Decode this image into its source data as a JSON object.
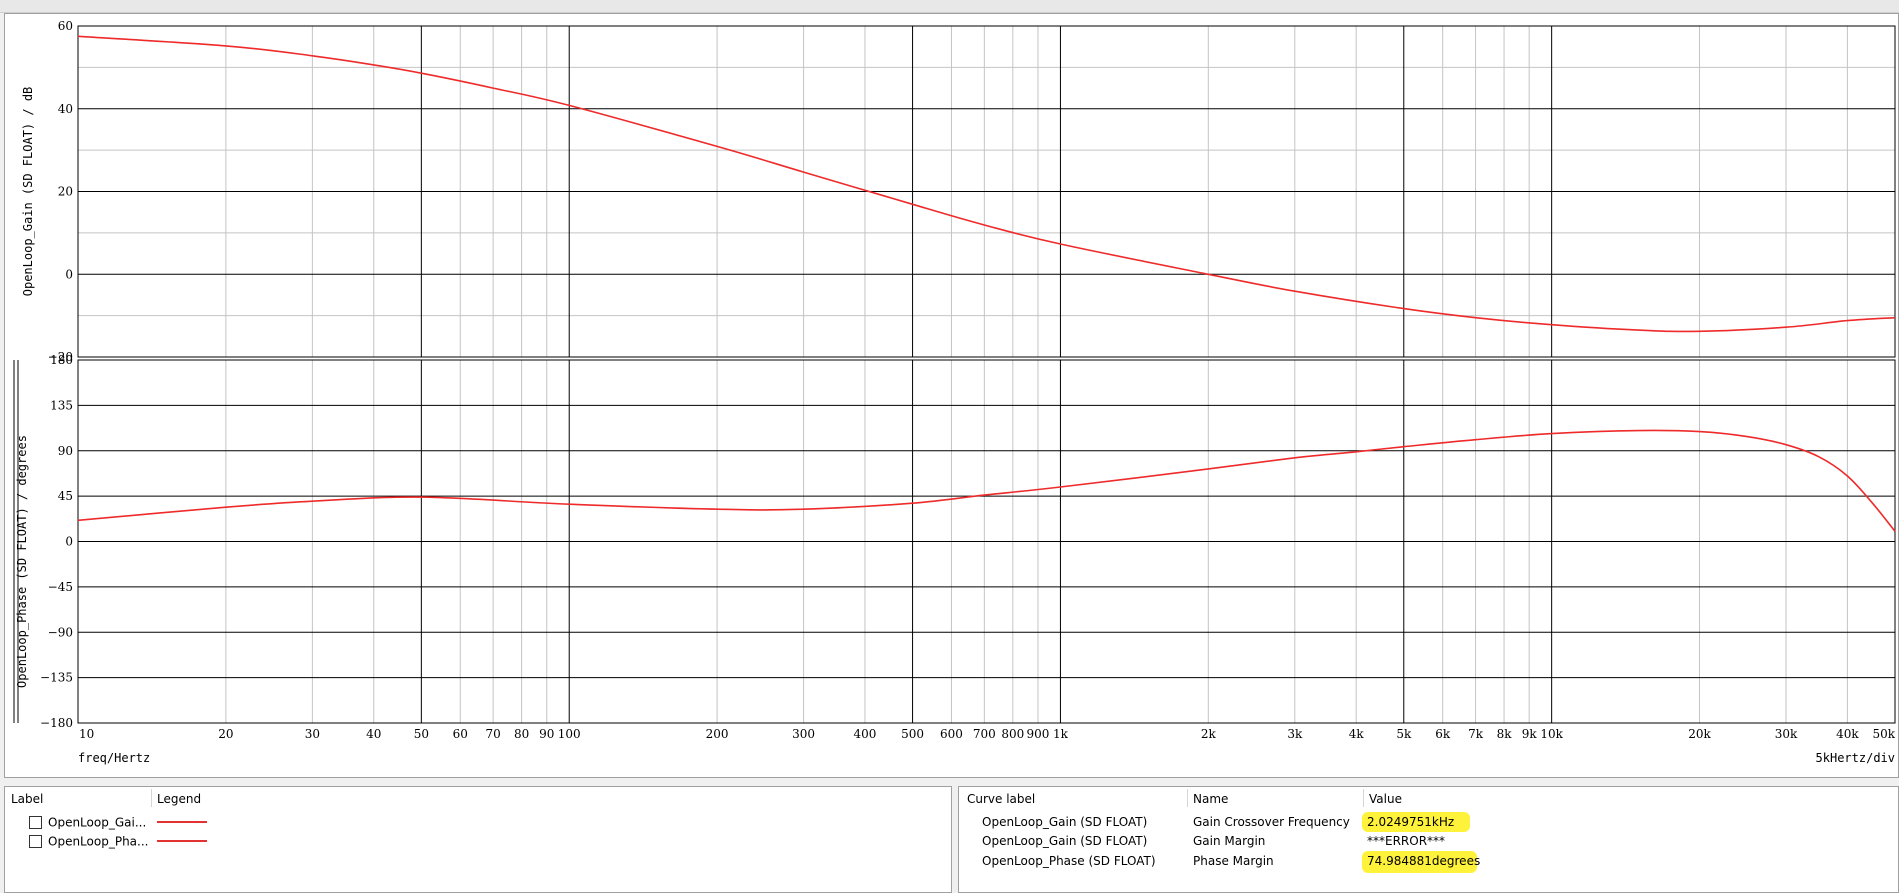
{
  "colors": {
    "curve": "#ee2a2a",
    "highlight": "#fff23a",
    "grid_major": "#000000",
    "grid_minor": "#c4c4c4"
  },
  "chart_data": [
    {
      "type": "line",
      "ylabel": "OpenLoop_Gain (SD FLOAT) / dB",
      "xscale": "log",
      "xlim": [
        10,
        50000
      ],
      "ylim": [
        -20,
        60
      ],
      "yticks": [
        60,
        40,
        20,
        0,
        -20
      ],
      "series": [
        {
          "name": "OpenLoop_Gain (SD FLOAT)",
          "x": [
            10,
            20,
            30,
            40,
            50,
            70,
            100,
            200,
            300,
            500,
            700,
            1000,
            2000,
            3000,
            5000,
            7000,
            10000,
            15000,
            20000,
            30000,
            40000,
            50000
          ],
          "y": [
            57.5,
            55.2,
            52.8,
            50.6,
            48.6,
            45.0,
            40.8,
            30.9,
            24.7,
            16.9,
            11.9,
            7.3,
            0.0,
            -4.1,
            -8.3,
            -10.5,
            -12.2,
            -13.5,
            -13.8,
            -12.8,
            -11.2,
            -10.5
          ]
        }
      ]
    },
    {
      "type": "line",
      "ylabel": "OpenLoop_Phase (SD FLOAT) / degrees",
      "xlabel": "freq/Hertz",
      "xscale": "log",
      "xlim": [
        10,
        50000
      ],
      "ylim": [
        -180,
        180
      ],
      "yticks": [
        180,
        135,
        90,
        45,
        0,
        -45,
        -90,
        -135,
        -180
      ],
      "xtick_labels": [
        "10",
        "20",
        "30",
        "40",
        "50",
        "60",
        "70",
        "80",
        "90",
        "100",
        "200",
        "300",
        "400",
        "500",
        "600",
        "700",
        "800",
        "900",
        "1k",
        "2k",
        "3k",
        "4k",
        "5k",
        "6k",
        "7k",
        "8k",
        "9k",
        "10k",
        "20k",
        "30k",
        "40k",
        "50k"
      ],
      "xtick_values": [
        10,
        20,
        30,
        40,
        50,
        60,
        70,
        80,
        90,
        100,
        200,
        300,
        400,
        500,
        600,
        700,
        800,
        900,
        1000,
        2000,
        3000,
        4000,
        5000,
        6000,
        7000,
        8000,
        9000,
        10000,
        20000,
        30000,
        40000,
        50000
      ],
      "scale_label": "5kHertz/div",
      "series": [
        {
          "name": "OpenLoop_Phase (SD FLOAT)",
          "x": [
            10,
            20,
            30,
            50,
            100,
            200,
            300,
            500,
            700,
            1000,
            2000,
            3000,
            4000,
            5000,
            7000,
            10000,
            15000,
            20000,
            25000,
            30000,
            35000,
            40000,
            45000,
            50000
          ],
          "y": [
            21,
            34,
            40,
            44,
            37,
            32,
            32,
            38,
            46,
            54,
            72,
            83,
            89,
            94,
            101,
            107,
            110,
            109,
            104,
            96,
            84,
            65,
            38,
            10
          ]
        }
      ]
    }
  ],
  "legend_panel": {
    "headers": [
      "Label",
      "Legend"
    ],
    "items": [
      {
        "label": "OpenLoop_Gai..."
      },
      {
        "label": "OpenLoop_Pha..."
      }
    ]
  },
  "measurements": {
    "headers": [
      "Curve label",
      "Name",
      "Value"
    ],
    "rows": [
      {
        "curve": "OpenLoop_Gain (SD FLOAT)",
        "name": "Gain Crossover Frequency",
        "value": "2.0249751kHz",
        "highlight": true
      },
      {
        "curve": "OpenLoop_Gain (SD FLOAT)",
        "name": "Gain Margin",
        "value": "***ERROR***",
        "highlight": false
      },
      {
        "curve": "OpenLoop_Phase (SD FLOAT)",
        "name": "Phase Margin",
        "value": "74.984881degrees",
        "highlight": true
      }
    ]
  }
}
